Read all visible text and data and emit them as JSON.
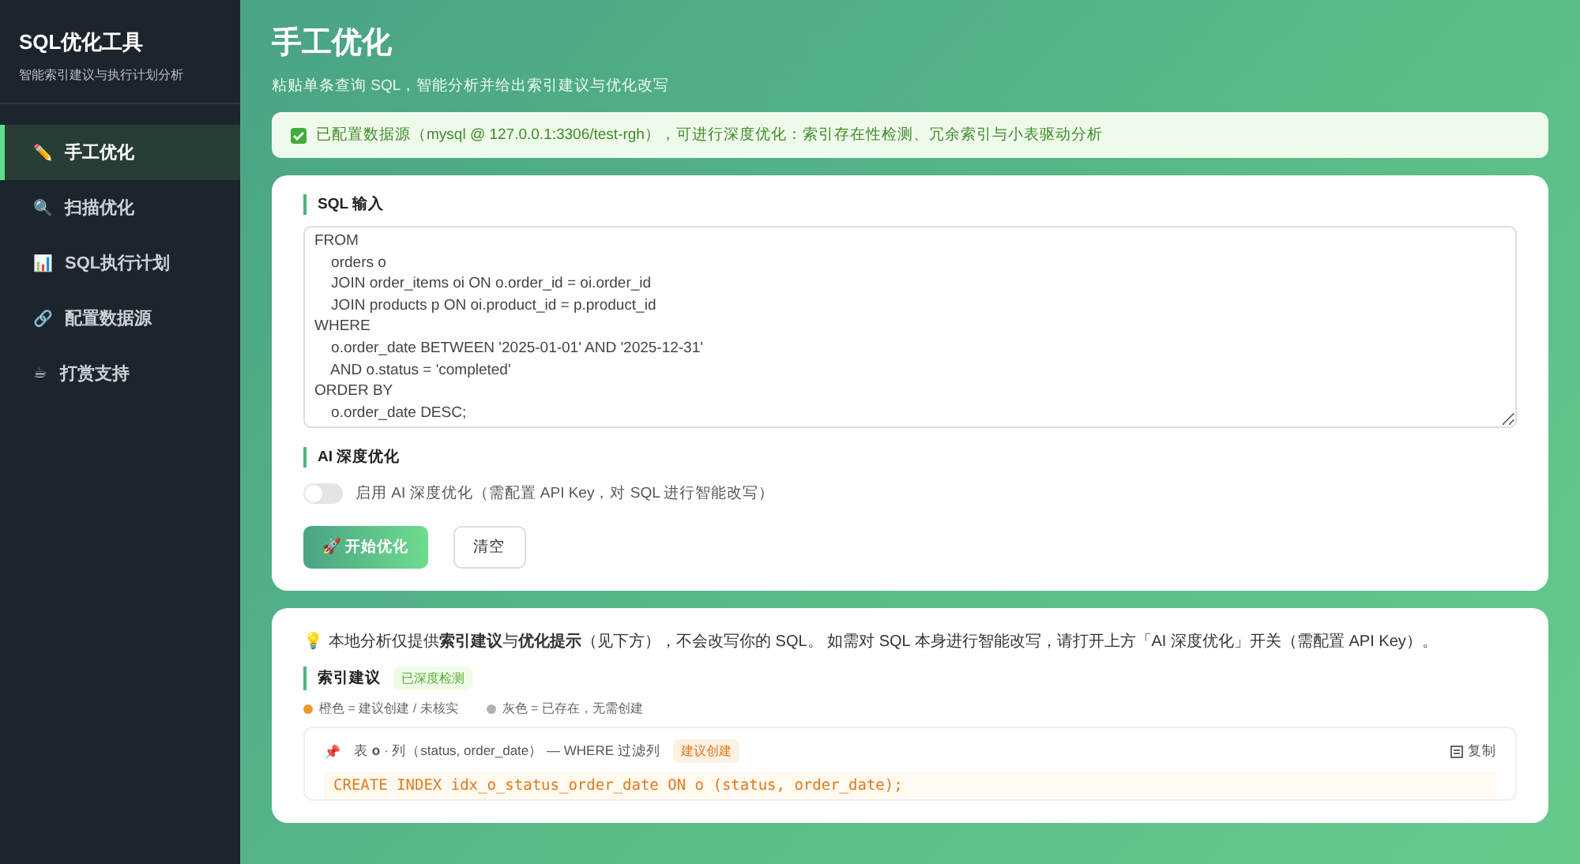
{
  "sidebar": {
    "title": "SQL优化工具",
    "subtitle": "智能索引建议与执行计划分析",
    "items": [
      {
        "icon": "✏️",
        "label": "手工优化",
        "selected": true
      },
      {
        "icon": "🔍",
        "label": "扫描优化",
        "selected": false
      },
      {
        "icon": "📊",
        "label": "SQL执行计划",
        "selected": false
      },
      {
        "icon": "🔗",
        "label": "配置数据源",
        "selected": false
      },
      {
        "icon": "☕",
        "label": "打赏支持",
        "selected": false
      }
    ]
  },
  "page": {
    "title": "手工优化",
    "subtitle": "粘贴单条查询 SQL，智能分析并给出索引建议与优化改写"
  },
  "banner": {
    "text": "已配置数据源（mysql @ 127.0.0.1:3306/test-rgh），可进行深度优化：索引存在性检测、冗余索引与小表驱动分析"
  },
  "input_card": {
    "sql_label": "SQL 输入",
    "sql": "FROM\n    orders o\n    JOIN order_items oi ON o.order_id = oi.order_id\n    JOIN products p ON oi.product_id = p.product_id\nWHERE\n    o.order_date BETWEEN '2025-01-01' AND '2025-12-31'\n    AND o.status = 'completed'\nORDER BY\n    o.order_date DESC;",
    "ai_label": "AI 深度优化",
    "ai_toggle": {
      "label": "启用 AI 深度优化（需配置 API Key，对 SQL 进行智能改写）",
      "on": false
    },
    "buttons": [
      {
        "kind": "primary",
        "label": "🚀 开始优化"
      },
      {
        "kind": "secondary",
        "label": "清空"
      }
    ]
  },
  "result_card": {
    "note_icon": "💡",
    "note": "本地分析仅提供**索引建议**与**优化提示**（见下方），不会改写你的 SQL。 如需对 SQL 本身进行智能改写，请打开上方「AI 深度优化」开关（需配置 API Key）。",
    "section": "索引建议",
    "section_badge": "已深度检测",
    "legend": [
      {
        "color": "#e89a2c",
        "label": "橙色 = 建议创建 / 未核实"
      },
      {
        "color": "#b0b0b0",
        "label": "灰色 = 已存在，无需创建"
      }
    ],
    "suggestion": {
      "icon": "📌",
      "title": "表 **o** · 列（status, order_date） — WHERE 过滤列",
      "badge": "建议创建",
      "copy": "复制",
      "code": "CREATE INDEX idx_o_status_order_date ON o (status, order_date);"
    }
  }
}
